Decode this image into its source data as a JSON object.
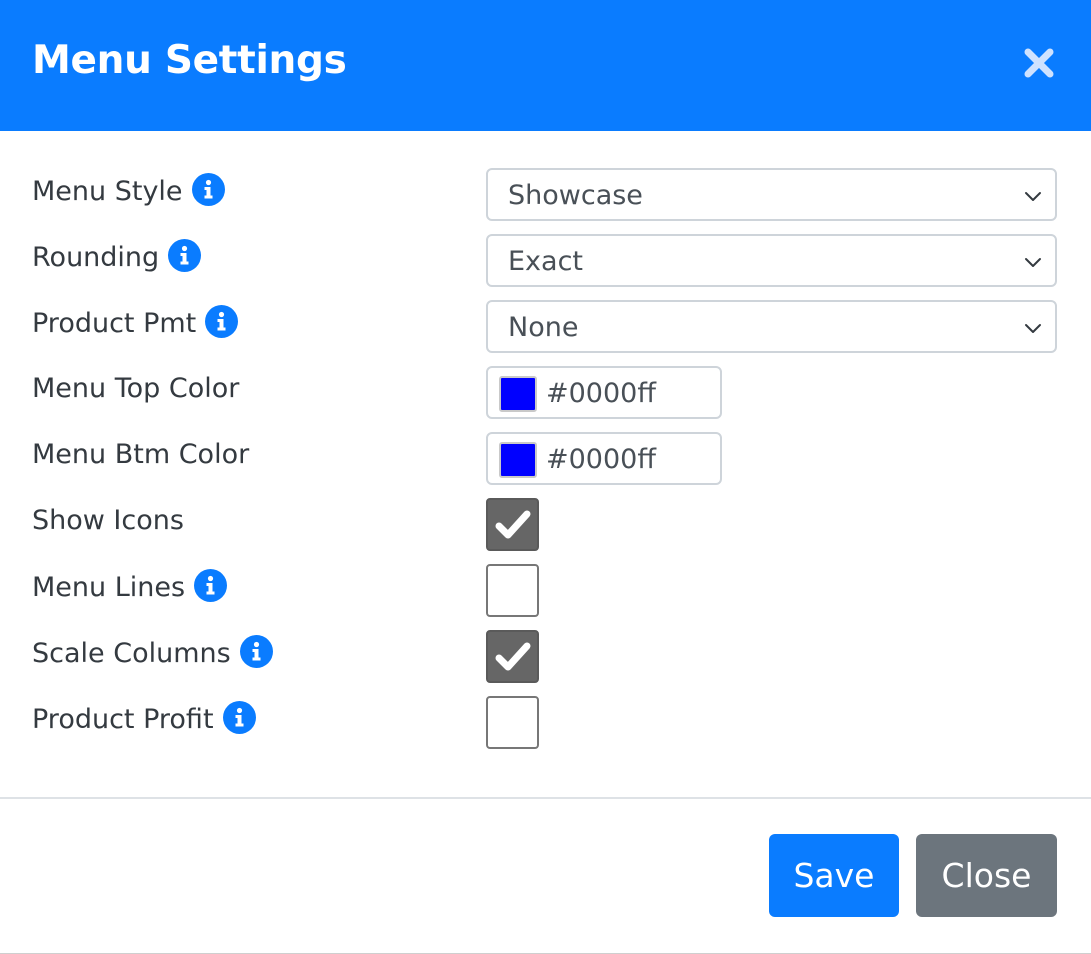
{
  "dialog": {
    "title": "Menu Settings",
    "close_icon": "close-icon"
  },
  "fields": [
    {
      "label": "Menu Style",
      "info": true,
      "type": "select",
      "value": "Showcase"
    },
    {
      "label": "Rounding",
      "info": true,
      "type": "select",
      "value": "Exact"
    },
    {
      "label": "Product Pmt",
      "info": true,
      "type": "select",
      "value": "None"
    },
    {
      "label": "Menu Top Color",
      "info": false,
      "type": "color",
      "value": "#0000ff"
    },
    {
      "label": "Menu Btm Color",
      "info": false,
      "type": "color",
      "value": "#0000ff"
    },
    {
      "label": "Show Icons",
      "info": false,
      "type": "checkbox",
      "checked": true
    },
    {
      "label": "Menu Lines",
      "info": true,
      "type": "checkbox",
      "checked": false
    },
    {
      "label": "Scale Columns",
      "info": true,
      "type": "checkbox",
      "checked": true
    },
    {
      "label": "Product Profit",
      "info": true,
      "type": "checkbox",
      "checked": false
    }
  ],
  "footer": {
    "save_label": "Save",
    "close_label": "Close"
  },
  "colors": {
    "primary": "#0a7cff",
    "secondary": "#6c757d",
    "checkbox_checked": "#666666"
  }
}
